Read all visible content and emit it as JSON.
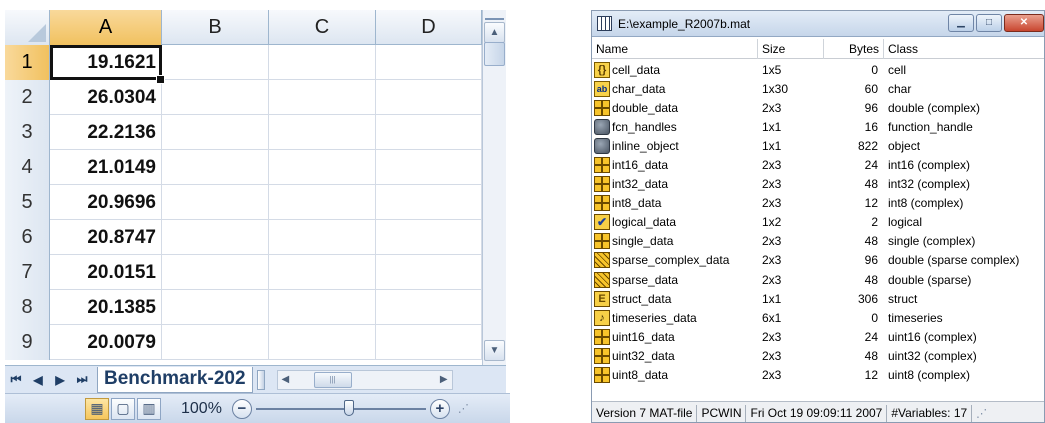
{
  "excel": {
    "columns": [
      "A",
      "B",
      "C",
      "D"
    ],
    "rows": [
      {
        "num": "1",
        "a": "19.1621"
      },
      {
        "num": "2",
        "a": "26.0304"
      },
      {
        "num": "3",
        "a": "22.2136"
      },
      {
        "num": "4",
        "a": "21.0149"
      },
      {
        "num": "5",
        "a": "20.9696"
      },
      {
        "num": "6",
        "a": "20.8747"
      },
      {
        "num": "7",
        "a": "20.0151"
      },
      {
        "num": "8",
        "a": "20.1385"
      },
      {
        "num": "9",
        "a": "20.0079"
      }
    ],
    "sheet_tab": "Benchmark-202",
    "zoom": "100%",
    "zoom_minus": "−",
    "zoom_plus": "+"
  },
  "matlab": {
    "title": "E:\\example_R2007b.mat",
    "headers": {
      "name": "Name",
      "size": "Size",
      "bytes": "Bytes",
      "class": "Class"
    },
    "variables": [
      {
        "icon": "cell-icon",
        "glyph": "{}",
        "name": "cell_data",
        "size": "1x5",
        "bytes": "0",
        "class": "cell"
      },
      {
        "icon": "char-icon",
        "glyph": "ab",
        "name": "char_data",
        "size": "1x30",
        "bytes": "60",
        "class": "char"
      },
      {
        "icon": "matrix-icon",
        "glyph": "",
        "name": "double_data",
        "size": "2x3",
        "bytes": "96",
        "class": "double (complex)"
      },
      {
        "icon": "object-icon",
        "glyph": "",
        "name": "fcn_handles",
        "size": "1x1",
        "bytes": "16",
        "class": "function_handle"
      },
      {
        "icon": "object-icon",
        "glyph": "",
        "name": "inline_object",
        "size": "1x1",
        "bytes": "822",
        "class": "object"
      },
      {
        "icon": "matrix-icon",
        "glyph": "",
        "name": "int16_data",
        "size": "2x3",
        "bytes": "24",
        "class": "int16 (complex)"
      },
      {
        "icon": "matrix-icon",
        "glyph": "",
        "name": "int32_data",
        "size": "2x3",
        "bytes": "48",
        "class": "int32 (complex)"
      },
      {
        "icon": "matrix-icon",
        "glyph": "",
        "name": "int8_data",
        "size": "2x3",
        "bytes": "12",
        "class": "int8 (complex)"
      },
      {
        "icon": "logical-icon",
        "glyph": "✔",
        "name": "logical_data",
        "size": "1x2",
        "bytes": "2",
        "class": "logical"
      },
      {
        "icon": "matrix-icon",
        "glyph": "",
        "name": "single_data",
        "size": "2x3",
        "bytes": "48",
        "class": "single (complex)"
      },
      {
        "icon": "sparse-icon",
        "glyph": "",
        "name": "sparse_complex_data",
        "size": "2x3",
        "bytes": "96",
        "class": "double (sparse complex)"
      },
      {
        "icon": "sparse-icon",
        "glyph": "",
        "name": "sparse_data",
        "size": "2x3",
        "bytes": "48",
        "class": "double (sparse)"
      },
      {
        "icon": "struct-icon",
        "glyph": "E",
        "name": "struct_data",
        "size": "1x1",
        "bytes": "306",
        "class": "struct"
      },
      {
        "icon": "timeseries-icon",
        "glyph": "♪",
        "name": "timeseries_data",
        "size": "6x1",
        "bytes": "0",
        "class": "timeseries"
      },
      {
        "icon": "matrix-icon",
        "glyph": "",
        "name": "uint16_data",
        "size": "2x3",
        "bytes": "24",
        "class": "uint16 (complex)"
      },
      {
        "icon": "matrix-icon",
        "glyph": "",
        "name": "uint32_data",
        "size": "2x3",
        "bytes": "48",
        "class": "uint32 (complex)"
      },
      {
        "icon": "matrix-icon",
        "glyph": "",
        "name": "uint8_data",
        "size": "2x3",
        "bytes": "12",
        "class": "uint8 (complex)"
      }
    ],
    "status": {
      "version": "Version 7 MAT-file",
      "platform": "PCWIN",
      "date": "Fri Oct 19 09:09:11 2007",
      "count": "#Variables: 17"
    }
  }
}
